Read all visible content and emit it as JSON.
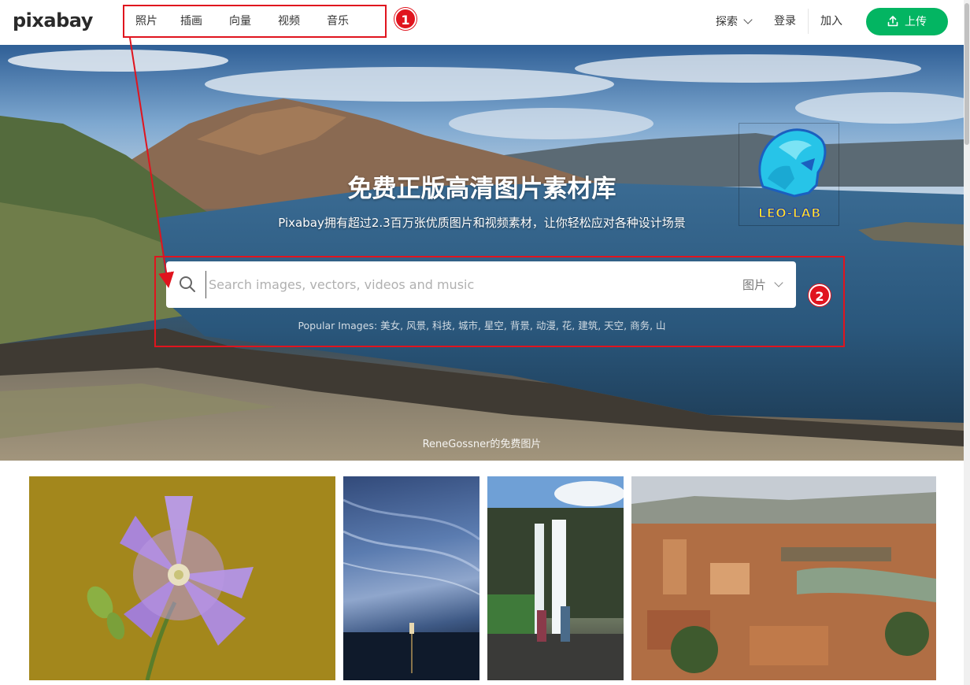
{
  "header": {
    "logo": "pixabay",
    "nav": [
      {
        "label": "照片"
      },
      {
        "label": "插画"
      },
      {
        "label": "向量"
      },
      {
        "label": "视频"
      },
      {
        "label": "音乐"
      }
    ],
    "explore_label": "探索",
    "login_label": "登录",
    "join_label": "加入",
    "upload_label": "上传"
  },
  "hero": {
    "title": "免费正版高清图片素材库",
    "subtitle": "Pixabay拥有超过2.3百万张优质图片和视频素材，让你轻松应对各种设计场景",
    "search": {
      "placeholder": "Search images, vectors, videos and music",
      "value": "",
      "type_selected": "图片"
    },
    "popular_prefix": "Popular Images:",
    "popular_terms": "美女, 风景, 科技, 城市, 星空, 背景, 动漫, 花, 建筑, 天空, 商务, 山",
    "credit": "ReneGossner的免费图片"
  },
  "watermark": {
    "text": "LEO-LAB"
  },
  "annotations": [
    {
      "label": "1"
    },
    {
      "label": "2"
    }
  ],
  "colors": {
    "accent_green": "#03b562",
    "annotation_red": "#e0141e"
  },
  "gallery": [
    {
      "subject": "purple-flower"
    },
    {
      "subject": "night-sky-lighthouse"
    },
    {
      "subject": "waterfall-couple"
    },
    {
      "subject": "florence-cityscape"
    }
  ]
}
